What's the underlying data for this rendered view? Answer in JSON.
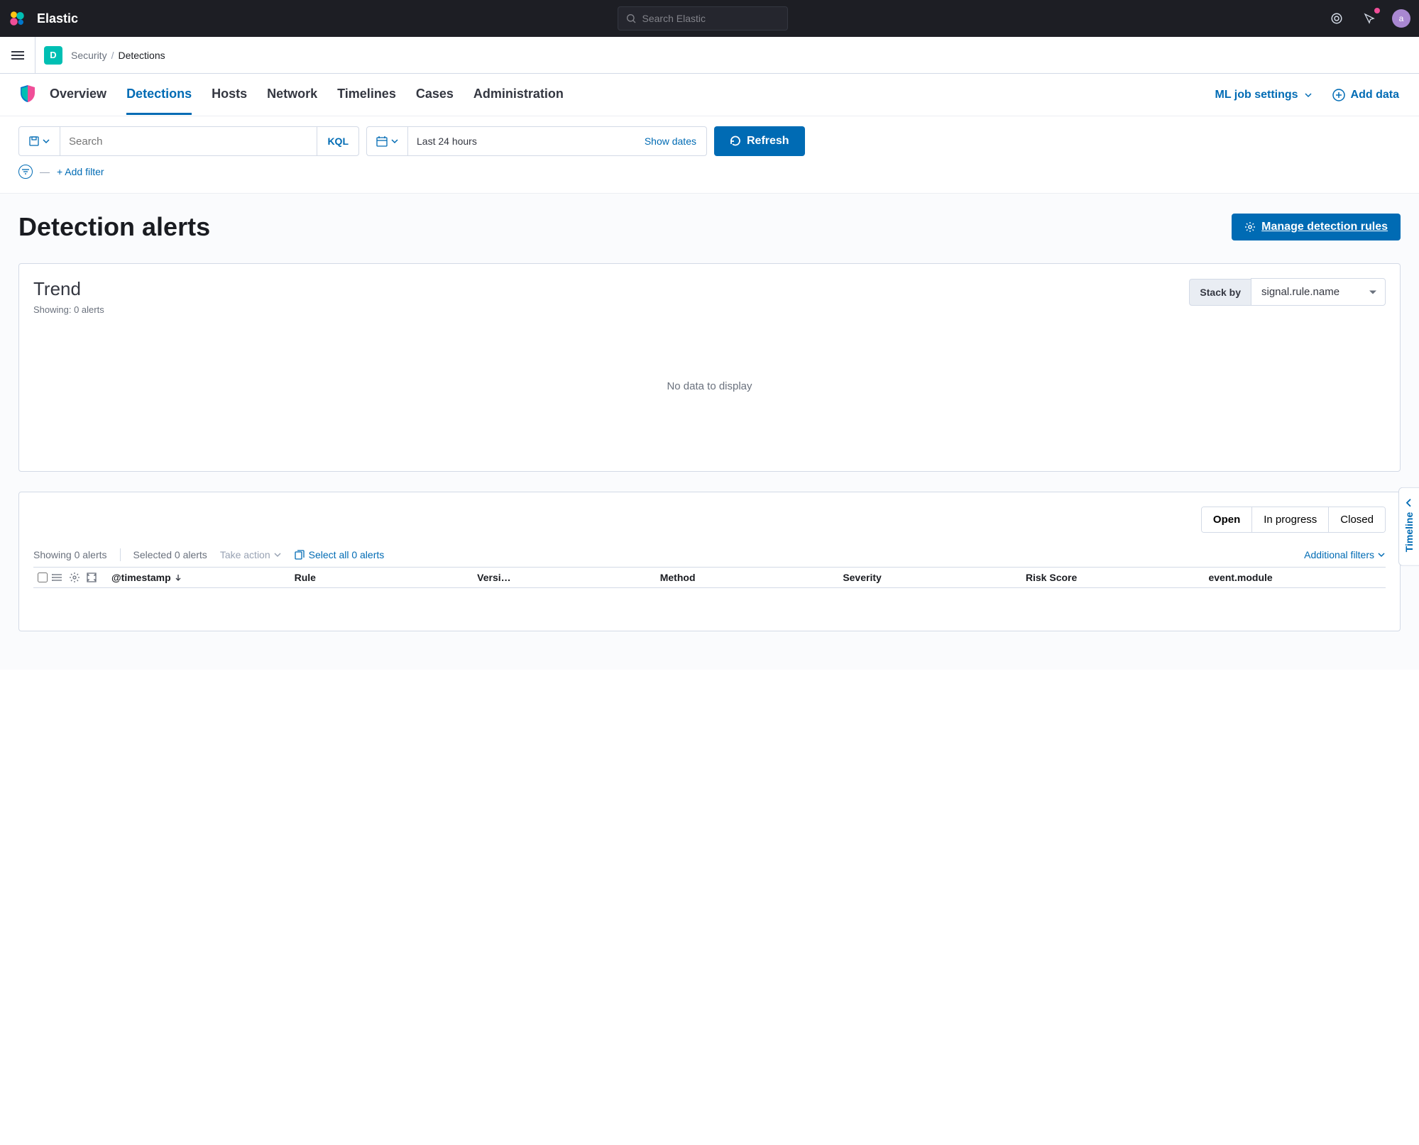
{
  "header": {
    "brand": "Elastic",
    "search_placeholder": "Search Elastic",
    "avatar_initial": "a"
  },
  "breadcrumb": {
    "app_badge": "D",
    "section": "Security",
    "current": "Detections"
  },
  "nav": {
    "tabs": [
      "Overview",
      "Detections",
      "Hosts",
      "Network",
      "Timelines",
      "Cases",
      "Administration"
    ],
    "active": "Detections",
    "ml_job": "ML job settings",
    "add_data": "Add data"
  },
  "query": {
    "search_placeholder": "Search",
    "kql": "KQL",
    "time_range": "Last 24 hours",
    "show_dates": "Show dates",
    "refresh": "Refresh",
    "add_filter": "+ Add filter"
  },
  "page": {
    "title": "Detection alerts",
    "manage_rules": "Manage detection rules"
  },
  "trend": {
    "title": "Trend",
    "showing": "Showing: 0 alerts",
    "stack_by_label": "Stack by",
    "stack_by_value": "signal.rule.name",
    "empty": "No data to display"
  },
  "alerts": {
    "status_tabs": [
      "Open",
      "In progress",
      "Closed"
    ],
    "status_active": "Open",
    "showing": "Showing 0 alerts",
    "selected": "Selected 0 alerts",
    "take_action": "Take action",
    "select_all": "Select all 0 alerts",
    "additional_filters": "Additional filters",
    "columns": {
      "timestamp": "@timestamp",
      "rule": "Rule",
      "version": "Versi…",
      "method": "Method",
      "severity": "Severity",
      "risk_score": "Risk Score",
      "event_module": "event.module"
    }
  },
  "timeline_handle": "Timeline"
}
